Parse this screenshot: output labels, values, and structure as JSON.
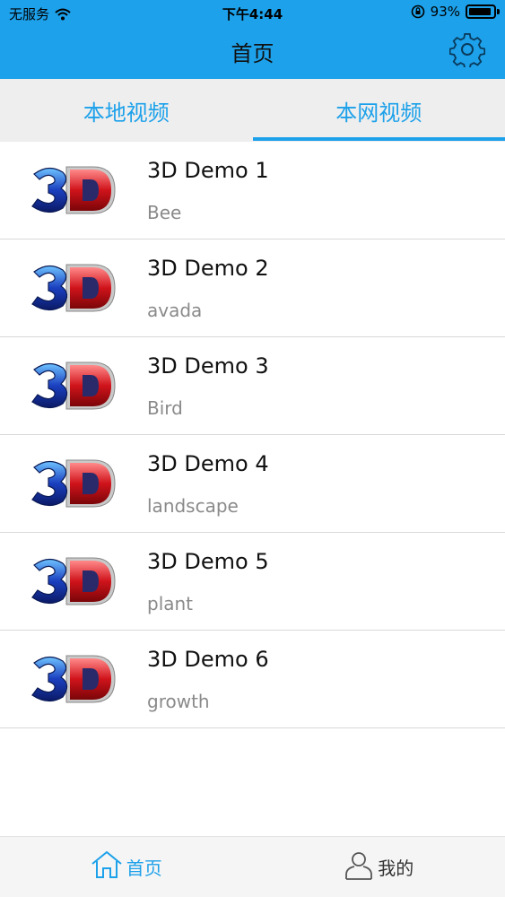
{
  "status_bar": {
    "carrier": "无服务",
    "time": "下午4:44",
    "battery": "93%",
    "battery_level": 0.93
  },
  "header": {
    "title": "首页",
    "settings_icon": "gear-icon"
  },
  "tabs": [
    {
      "label": "本地视频",
      "active": false
    },
    {
      "label": "本网视频",
      "active": true
    }
  ],
  "videos": [
    {
      "title": "3D Demo 1",
      "subtitle": "Bee"
    },
    {
      "title": "3D Demo 2",
      "subtitle": "avada"
    },
    {
      "title": "3D Demo 3",
      "subtitle": "Bird"
    },
    {
      "title": "3D Demo 4",
      "subtitle": "landscape"
    },
    {
      "title": "3D Demo 5",
      "subtitle": "plant"
    },
    {
      "title": "3D Demo 6",
      "subtitle": "growth"
    }
  ],
  "bottom_tabs": [
    {
      "label": "首页",
      "icon": "home-icon",
      "active": true
    },
    {
      "label": "我的",
      "icon": "person-icon",
      "active": false
    }
  ],
  "colors": {
    "accent": "#1da1ea",
    "tab_background": "#eeeeee",
    "divider": "#d8d8d8",
    "subtitle": "#8a8a8a"
  }
}
